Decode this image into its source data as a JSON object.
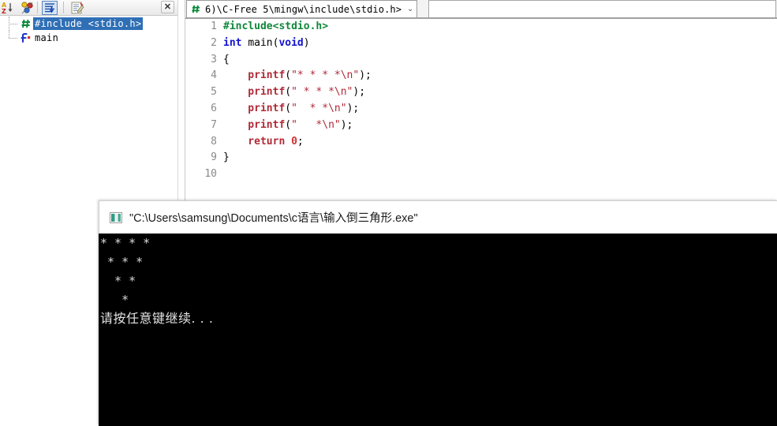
{
  "app": {
    "title": "C-Free 5 IDE"
  },
  "left_panel": {
    "toolbar": {
      "buttons": [
        {
          "name": "sort-az-icon",
          "label": "Sort A-Z"
        },
        {
          "name": "group-shapes-icon",
          "label": "Group Members"
        },
        {
          "name": "expand-list-icon",
          "label": "Show Symbol List"
        },
        {
          "name": "edit-document-icon",
          "label": "Edit Properties"
        }
      ],
      "close_label": "✕"
    },
    "tree": {
      "items": [
        {
          "icon": "hash-icon",
          "label": "#include <stdio.h>",
          "selected": true
        },
        {
          "icon": "function-f-icon",
          "label": "main",
          "selected": false
        }
      ]
    }
  },
  "editor": {
    "tab": {
      "icon": "hash-icon",
      "title": "6)\\C-Free 5\\mingw\\include\\stdio.h>",
      "chevron": "⌄"
    },
    "lines": [
      {
        "num": "1",
        "tokens": [
          {
            "t": "#include",
            "c": "pre"
          },
          {
            "t": "<stdio.h>",
            "c": "pre"
          }
        ]
      },
      {
        "num": "2",
        "tokens": [
          {
            "t": "int ",
            "c": "kw"
          },
          {
            "t": "main",
            "c": "plain"
          },
          {
            "t": "(",
            "c": "punc"
          },
          {
            "t": "void",
            "c": "kw"
          },
          {
            "t": ")",
            "c": "punc"
          }
        ]
      },
      {
        "num": "3",
        "tokens": [
          {
            "t": "{",
            "c": "punc"
          }
        ]
      },
      {
        "num": "4",
        "tokens": [
          {
            "t": "    printf",
            "c": "fn"
          },
          {
            "t": "(",
            "c": "punc"
          },
          {
            "t": "\"* * * *\\n\"",
            "c": "str"
          },
          {
            "t": ");",
            "c": "punc"
          }
        ]
      },
      {
        "num": "5",
        "tokens": [
          {
            "t": "    printf",
            "c": "fn"
          },
          {
            "t": "(",
            "c": "punc"
          },
          {
            "t": "\" * * *\\n\"",
            "c": "str"
          },
          {
            "t": ");",
            "c": "punc"
          }
        ]
      },
      {
        "num": "6",
        "tokens": [
          {
            "t": "    printf",
            "c": "fn"
          },
          {
            "t": "(",
            "c": "punc"
          },
          {
            "t": "\"  * *\\n\"",
            "c": "str"
          },
          {
            "t": ");",
            "c": "punc"
          }
        ]
      },
      {
        "num": "7",
        "tokens": [
          {
            "t": "    printf",
            "c": "fn"
          },
          {
            "t": "(",
            "c": "punc"
          },
          {
            "t": "\"   *\\n\"",
            "c": "str"
          },
          {
            "t": ");",
            "c": "punc"
          }
        ]
      },
      {
        "num": "8",
        "tokens": [
          {
            "t": "    return ",
            "c": "fn"
          },
          {
            "t": "0",
            "c": "num"
          },
          {
            "t": ";",
            "c": "punc"
          }
        ]
      },
      {
        "num": "9",
        "tokens": [
          {
            "t": "}",
            "c": "punc"
          }
        ]
      },
      {
        "num": "10",
        "tokens": []
      }
    ]
  },
  "console": {
    "icon": "console-window-icon",
    "title": "\"C:\\Users\\samsung\\Documents\\c语言\\输入倒三角形.exe\"",
    "output": [
      {
        "text": "* * * *",
        "cjk": false
      },
      {
        "text": " * * *",
        "cjk": false
      },
      {
        "text": "  * *",
        "cjk": false
      },
      {
        "text": "   *",
        "cjk": false
      },
      {
        "text": "请按任意键继续. . .",
        "cjk": true
      }
    ]
  },
  "colors": {
    "selection_blue": "#2f6fb5",
    "preprocessor_green": "#11873b",
    "keyword_blue": "#1414cf",
    "string_red": "#b02a37",
    "console_bg": "#000000",
    "console_fg": "#d8d8d8"
  }
}
